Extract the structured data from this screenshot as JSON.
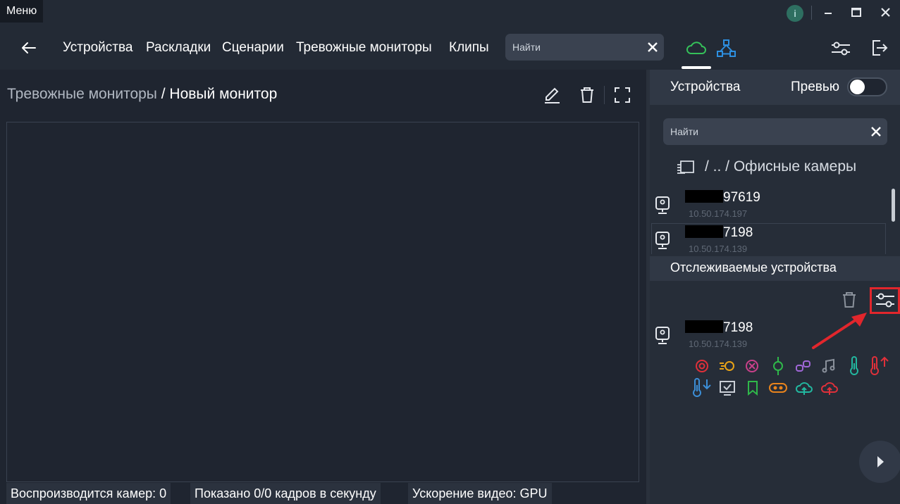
{
  "titlebar": {
    "menu_label": "Меню",
    "info_label": "i"
  },
  "nav": {
    "items": [
      "Устройства",
      "Раскладки",
      "Сценарии",
      "Тревожные мониторы",
      "Клипы"
    ],
    "search_placeholder": "Найти"
  },
  "breadcrumb": {
    "parent": "Тревожные мониторы",
    "separator": " / ",
    "current": "Новый монитор"
  },
  "status_bar": {
    "cameras": "Воспроизводится камер: 0",
    "fps": "Показано 0/0 кадров в секунду",
    "accel": "Ускорение видео: GPU"
  },
  "devices_panel": {
    "title": "Устройства",
    "preview_label": "Превью",
    "preview_on": false,
    "search_placeholder": "Найти",
    "folder_path": "/ .. / Офисные камеры",
    "devices": [
      {
        "name_suffix": "97619",
        "ip": "10.50.174.197"
      },
      {
        "name_suffix": "7198",
        "ip": "10.50.174.139"
      }
    ]
  },
  "tracked_panel": {
    "title": "Отслеживаемые устройства",
    "device": {
      "name_suffix": "7198",
      "ip": "10.50.174.139"
    },
    "event_icons": [
      {
        "name": "target-event-icon",
        "color": "#e0303a"
      },
      {
        "name": "motion-event-icon",
        "color": "#e8a317"
      },
      {
        "name": "tamper-event-icon",
        "color": "#c8408a"
      },
      {
        "name": "line-cross-event-icon",
        "color": "#2fb84a"
      },
      {
        "name": "link-event-icon",
        "color": "#a067d8"
      },
      {
        "name": "audio-event-icon",
        "color": "#8a919b"
      },
      {
        "name": "temperature-event-icon",
        "color": "#22b8a0"
      },
      {
        "name": "temperature-high-icon",
        "color": "#e0303a"
      },
      {
        "name": "temperature-low-icon",
        "color": "#3c8fd8"
      },
      {
        "name": "screen-check-icon",
        "color": "#c9ced6"
      },
      {
        "name": "bookmark-event-icon",
        "color": "#2fb84a"
      },
      {
        "name": "toggle-event-icon",
        "color": "#e8831c"
      },
      {
        "name": "cloud-upload-icon",
        "color": "#22b8a0"
      },
      {
        "name": "cloud-error-icon",
        "color": "#e0303a"
      }
    ]
  },
  "colors": {
    "accent_green": "#35c25a",
    "accent_blue": "#2d8fe0",
    "highlight_red": "#e2262c"
  }
}
